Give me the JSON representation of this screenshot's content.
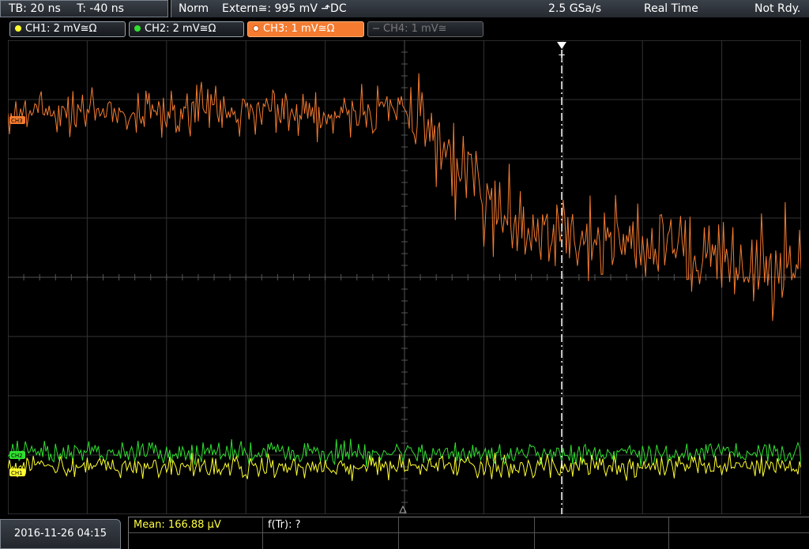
{
  "header": {
    "timebase": "TB: 20 ns",
    "trigger_time": "T: -40 ns",
    "acq_mode": "Norm",
    "trigger_source": "Extern≅: 995 mV ⬏DC",
    "sample_rate": "2.5 GSa/s",
    "mode": "Real Time",
    "state": "Not Rdy."
  },
  "channels": [
    {
      "label": "CH1: 2 mV≅Ω",
      "color": "#ffff30",
      "state": "on"
    },
    {
      "label": "CH2: 2 mV≅Ω",
      "color": "#30e030",
      "state": "on"
    },
    {
      "label": "CH3: 1 mV≅Ω",
      "color": "#f47b30",
      "state": "selected"
    },
    {
      "label": "CH4: 1 mV≅",
      "color": "#777777",
      "state": "off"
    }
  ],
  "markers": {
    "trigger": "T",
    "ch1": "CH1",
    "ch2": "CH2",
    "ch3": "CH3"
  },
  "footer": {
    "datetime": "2016-11-26 04:15",
    "mean": "Mean: 166.88 µV",
    "ftr": "f(Tr): ?"
  }
}
